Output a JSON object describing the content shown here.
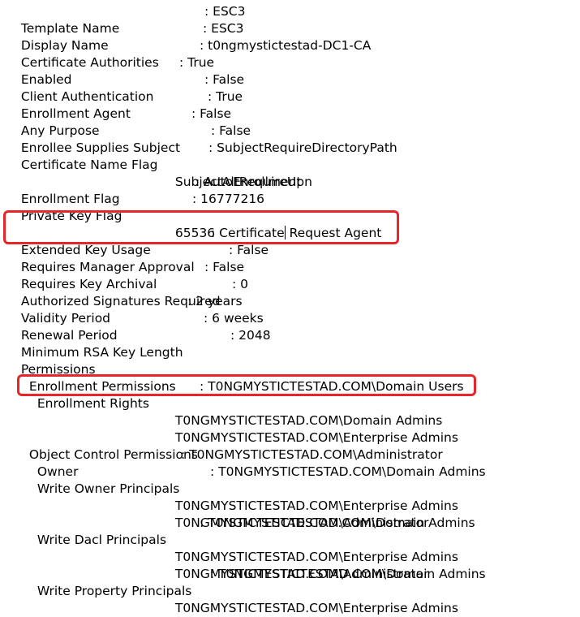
{
  "rows": [
    {
      "label": "Template Name",
      "value": ": ESC3"
    },
    {
      "label": "Display Name",
      "value": ": ESC3"
    },
    {
      "label": "Certificate Authorities",
      "value": ": t0ngmystictestad-DC1-CA"
    },
    {
      "label": "Enabled",
      "value": ": True"
    },
    {
      "label": "Client Authentication",
      "value": ": False"
    },
    {
      "label": "Enrollment Agent",
      "value": ": True"
    },
    {
      "label": "Any Purpose",
      "value": ": False"
    },
    {
      "label": "Enrollee Supplies Subject",
      "value": ": False"
    },
    {
      "label": "Certificate Name Flag",
      "value": ": SubjectRequireDirectoryPath"
    },
    {
      "label": "",
      "value": "SubjectAltRequireUpn"
    },
    {
      "label": "Enrollment Flag",
      "value": ": AutoEnrollment"
    },
    {
      "label": "Private Key Flag",
      "value": ": 16777216"
    },
    {
      "label": "",
      "value": "65536"
    },
    {
      "label": "Extended Key Usage",
      "value_part1": ": Certificate",
      "value_part2": " Request Agent"
    },
    {
      "label": "Requires Manager Approval",
      "value": ": False"
    },
    {
      "label": "Requires Key Archival",
      "value": ": False"
    },
    {
      "label": "Authorized Signatures Required",
      "value": ": 0"
    },
    {
      "label": "Validity Period",
      "value": ": 2 years"
    },
    {
      "label": "Renewal Period",
      "value": ": 6 weeks"
    },
    {
      "label": "Minimum RSA Key Length",
      "value": ": 2048"
    },
    {
      "label": "Permissions",
      "value": ""
    },
    {
      "label": "Enrollment Permissions",
      "value": ""
    },
    {
      "label": "Enrollment Rights",
      "value": ": T0NGMYSTICTESTAD.COM\\Domain Users"
    },
    {
      "label": "",
      "value": "T0NGMYSTICTESTAD.COM\\Domain Admins"
    },
    {
      "label": "",
      "value": "T0NGMYSTICTESTAD.COM\\Enterprise Admins"
    },
    {
      "label": "Object Control Permissions",
      "value": ""
    },
    {
      "label": "Owner",
      "value": ": T0NGMYSTICTESTAD.COM\\Administrator"
    },
    {
      "label": "Write Owner Principals",
      "value": ": T0NGMYSTICTESTAD.COM\\Domain Admins"
    },
    {
      "label": "",
      "value": "T0NGMYSTICTESTAD.COM\\Enterprise Admins"
    },
    {
      "label": "",
      "value": "T0NGMYSTICTESTAD.COM\\Administrator"
    },
    {
      "label": "Write Dacl Principals",
      "value": ": T0NGMYSTICTESTAD.COM\\Domain Admins"
    },
    {
      "label": "",
      "value": "T0NGMYSTICTESTAD.COM\\Enterprise Admins"
    },
    {
      "label": "",
      "value": "T0NGMYSTICTESTAD.COM\\Administrator"
    },
    {
      "label": "Write Property Principals",
      "value": ": T0NGMYSTICTESTAD.COM\\Domain Admins"
    },
    {
      "label": "",
      "value": "T0NGMYSTICTESTAD.COM\\Enterprise Admins"
    }
  ],
  "highlight_color": "#e8252a"
}
